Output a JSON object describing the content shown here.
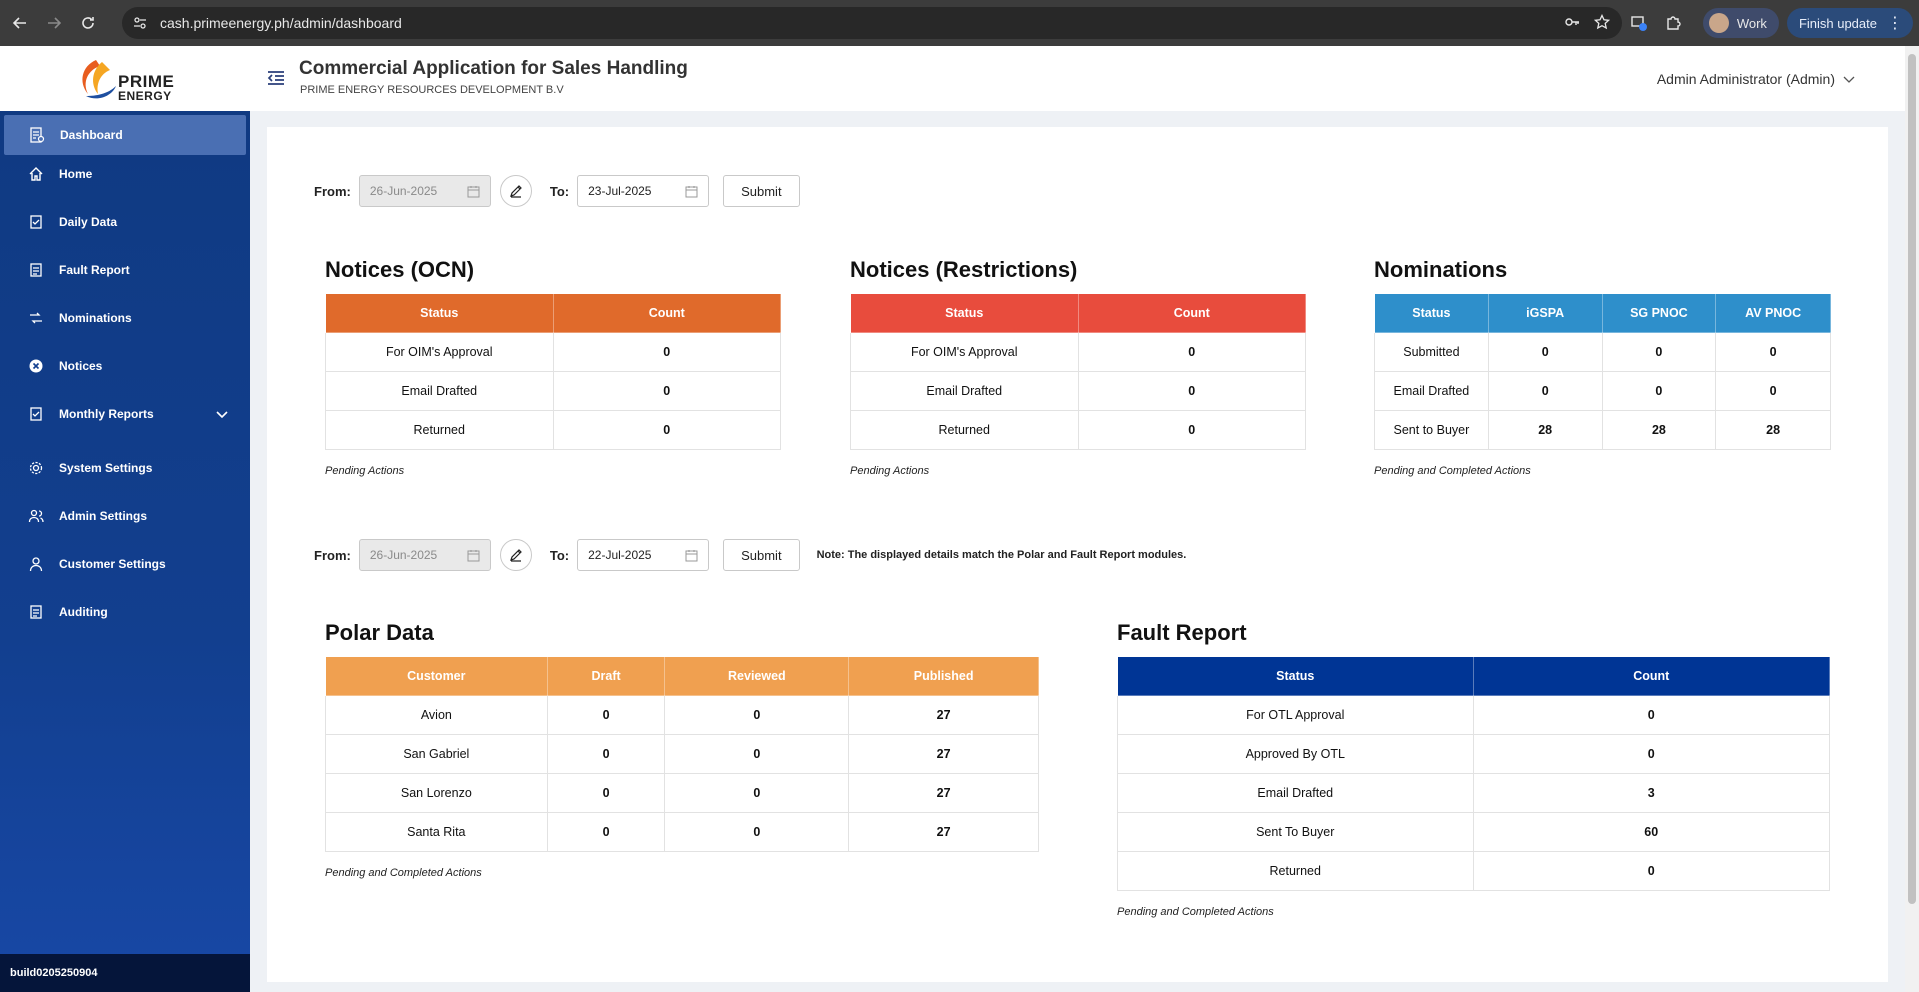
{
  "browser": {
    "url": "cash.primeenergy.ph/admin/dashboard",
    "profile_label": "Work",
    "update_label": "Finish update"
  },
  "header": {
    "logo_line1": "PRIME",
    "logo_line2": "ENERGY",
    "title": "Commercial Application for Sales Handling",
    "subtitle": "PRIME ENERGY RESOURCES DEVELOPMENT B.V",
    "user": "Admin Administrator (Admin)"
  },
  "sidebar": {
    "items": [
      {
        "label": "Dashboard",
        "icon": "dashboard-icon"
      },
      {
        "label": "Home",
        "icon": "home-icon"
      },
      {
        "label": "Daily Data",
        "icon": "daily-data-icon"
      },
      {
        "label": "Fault Report",
        "icon": "fault-report-icon"
      },
      {
        "label": "Nominations",
        "icon": "nominations-icon"
      },
      {
        "label": "Notices",
        "icon": "notices-icon"
      },
      {
        "label": "Monthly Reports",
        "icon": "monthly-reports-icon"
      },
      {
        "label": "System Settings",
        "icon": "gear-icon"
      },
      {
        "label": "Admin Settings",
        "icon": "users-icon"
      },
      {
        "label": "Customer Settings",
        "icon": "user-icon"
      },
      {
        "label": "Auditing",
        "icon": "auditing-icon"
      }
    ],
    "build": "build0205250904"
  },
  "filter1": {
    "from_label": "From:",
    "from_value": "26-Jun-2025",
    "to_label": "To:",
    "to_value": "23-Jul-2025",
    "submit": "Submit"
  },
  "filter2": {
    "from_label": "From:",
    "from_value": "26-Jun-2025",
    "to_label": "To:",
    "to_value": "22-Jul-2025",
    "submit": "Submit",
    "note": "Note: The displayed details match the Polar and Fault Report modules."
  },
  "colors": {
    "ocn": "#e06a2b",
    "restrictions": "#e84c3d",
    "nominations": "#2e8fcb",
    "polar": "#f0a050",
    "fault": "#003595"
  },
  "ocn": {
    "title": "Notices (OCN)",
    "headers": [
      "Status",
      "Count"
    ],
    "rows": [
      [
        "For OIM's Approval",
        "0"
      ],
      [
        "Email Drafted",
        "0"
      ],
      [
        "Returned",
        "0"
      ]
    ],
    "caption": "Pending Actions"
  },
  "restrictions": {
    "title": "Notices (Restrictions)",
    "headers": [
      "Status",
      "Count"
    ],
    "rows": [
      [
        "For OIM's Approval",
        "0"
      ],
      [
        "Email Drafted",
        "0"
      ],
      [
        "Returned",
        "0"
      ]
    ],
    "caption": "Pending Actions"
  },
  "nominations": {
    "title": "Nominations",
    "headers": [
      "Status",
      "iGSPA",
      "SG PNOC",
      "AV PNOC"
    ],
    "rows": [
      [
        "Submitted",
        "0",
        "0",
        "0"
      ],
      [
        "Email Drafted",
        "0",
        "0",
        "0"
      ],
      [
        "Sent to Buyer",
        "28",
        "28",
        "28"
      ]
    ],
    "caption": "Pending and Completed Actions"
  },
  "polar": {
    "title": "Polar Data",
    "headers": [
      "Customer",
      "Draft",
      "Reviewed",
      "Published"
    ],
    "rows": [
      [
        "Avion",
        "0",
        "0",
        "27"
      ],
      [
        "San Gabriel",
        "0",
        "0",
        "27"
      ],
      [
        "San Lorenzo",
        "0",
        "0",
        "27"
      ],
      [
        "Santa Rita",
        "0",
        "0",
        "27"
      ]
    ],
    "caption": "Pending and Completed Actions"
  },
  "fault": {
    "title": "Fault Report",
    "headers": [
      "Status",
      "Count"
    ],
    "rows": [
      [
        "For OTL Approval",
        "0"
      ],
      [
        "Approved By OTL",
        "0"
      ],
      [
        "Email Drafted",
        "3"
      ],
      [
        "Sent To Buyer",
        "60"
      ],
      [
        "Returned",
        "0"
      ]
    ],
    "caption": "Pending and Completed Actions"
  }
}
